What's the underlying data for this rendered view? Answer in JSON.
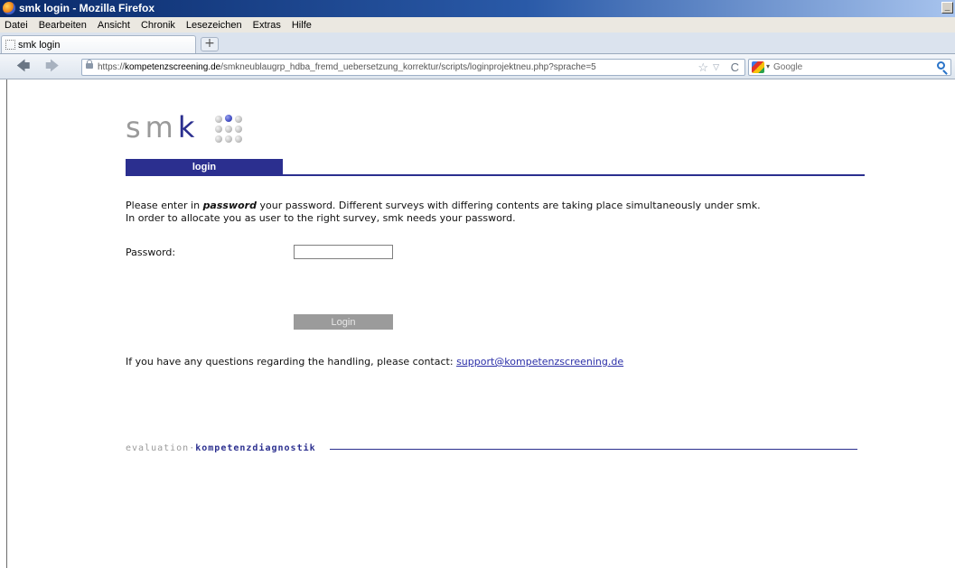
{
  "window": {
    "title": "smk login - Mozilla Firefox"
  },
  "menubar": {
    "items": [
      "Datei",
      "Bearbeiten",
      "Ansicht",
      "Chronik",
      "Lesezeichen",
      "Extras",
      "Hilfe"
    ]
  },
  "tabs": [
    {
      "label": "smk login"
    }
  ],
  "navbar": {
    "url_prefix": "https://",
    "url_domain": "kompetenzscreening.de",
    "url_path": "/smkneublaugrp_hdba_fremd_uebersetzung_korrektur/scripts/loginprojektneu.php?sprache=5",
    "search_placeholder": "Google"
  },
  "page": {
    "logo_text": "smk",
    "tab_label": "login",
    "intro_line1_a": "Please enter in ",
    "intro_line1_em": "password",
    "intro_line1_b": " your password. Different surveys with differing contents are taking place simultaneously under smk.",
    "intro_line2": "In order to allocate you as user to the right survey, smk needs your password.",
    "password_label": "Password:",
    "password_value": "",
    "login_button": "Login",
    "contact_text": "If you have any questions regarding the handling, please contact: ",
    "contact_email": "support@kompetenzscreening.de",
    "footer_part1": "evaluation·",
    "footer_part2": "kompetenzdiagnostik"
  },
  "colors": {
    "brand_blue": "#2b2f8f",
    "logo_grey": "#9a9a9a",
    "button_grey": "#9b9b9b"
  }
}
